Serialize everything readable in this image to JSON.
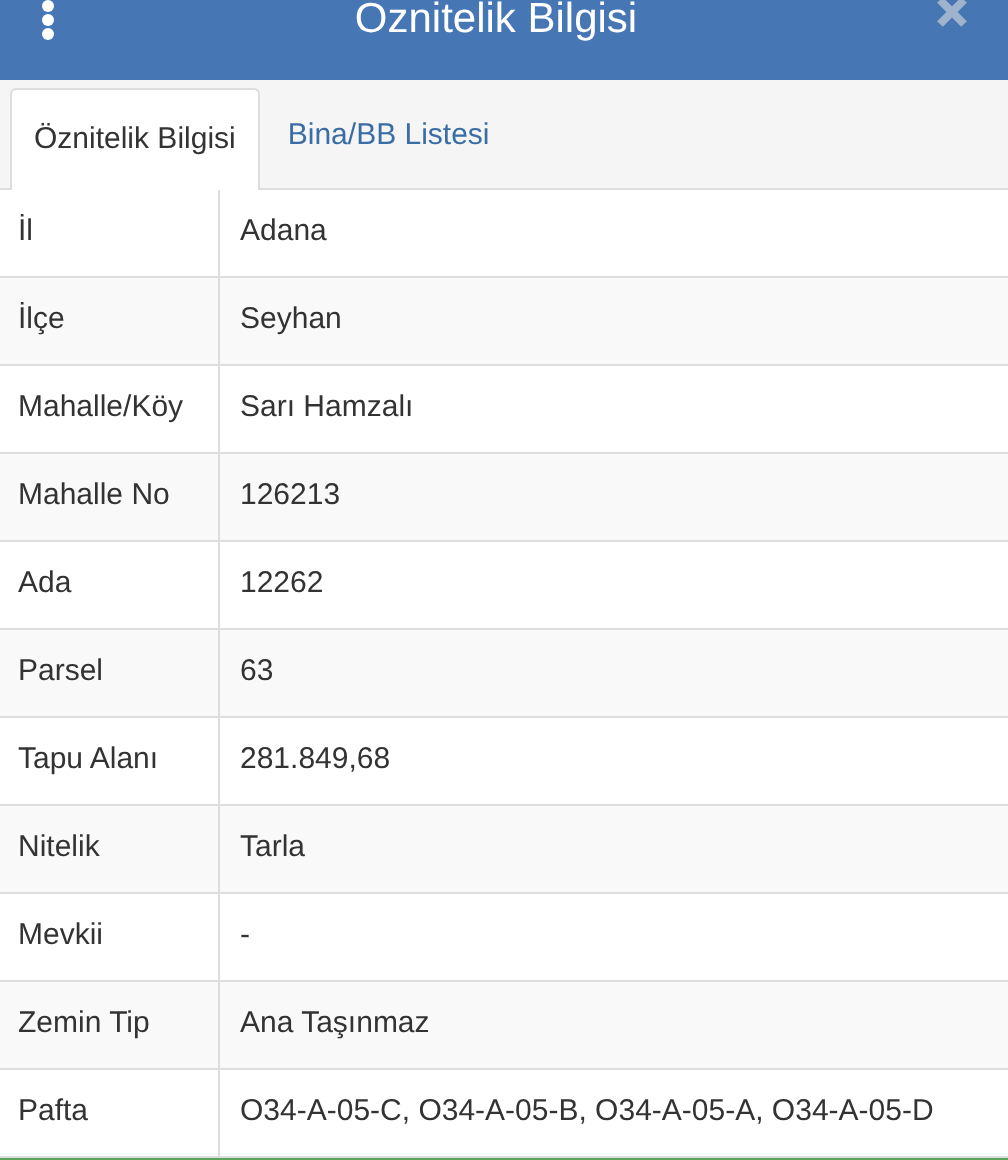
{
  "header": {
    "title": "Oznitelik Bilgisi"
  },
  "tabs": [
    {
      "label": "Öznitelik Bilgisi",
      "selected": true
    },
    {
      "label": "Bina/BB Listesi",
      "selected": false
    }
  ],
  "rows": [
    {
      "label": "İl",
      "value": "Adana"
    },
    {
      "label": "İlçe",
      "value": "Seyhan"
    },
    {
      "label": "Mahalle/Köy",
      "value": "Sarı Hamzalı"
    },
    {
      "label": "Mahalle No",
      "value": "126213"
    },
    {
      "label": "Ada",
      "value": "12262"
    },
    {
      "label": "Parsel",
      "value": "63"
    },
    {
      "label": "Tapu Alanı",
      "value": "281.849,68"
    },
    {
      "label": "Nitelik",
      "value": "Tarla"
    },
    {
      "label": "Mevkii",
      "value": "-"
    },
    {
      "label": "Zemin Tip",
      "value": "Ana Taşınmaz"
    },
    {
      "label": "Pafta",
      "value": "O34-A-05-C, O34-A-05-B, O34-A-05-A, O34-A-05-D"
    }
  ]
}
